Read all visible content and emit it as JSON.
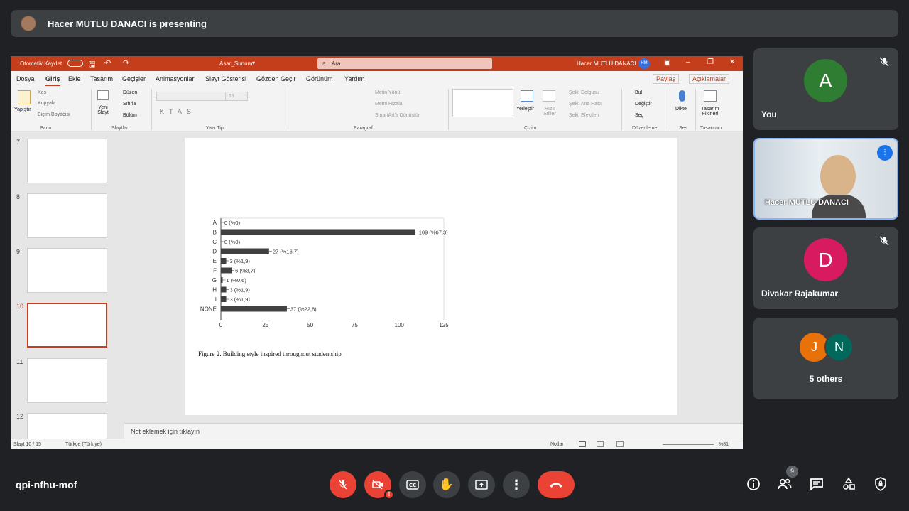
{
  "presenter_bar": {
    "text": "Hacer MUTLU DANACI is presenting"
  },
  "ppt": {
    "autosave": "Otomatik Kaydet",
    "filename": "Asar_Sunum",
    "search_placeholder": "Ara",
    "user_name": "Hacer MUTLU DANACI",
    "user_initials": "HM",
    "menus": [
      "Dosya",
      "Giriş",
      "Ekle",
      "Tasarım",
      "Geçişler",
      "Animasyonlar",
      "Slayt Gösterisi",
      "Gözden Geçir",
      "Görünüm",
      "Yardım"
    ],
    "share": "Paylaş",
    "comments": "Açıklamalar",
    "ribbon": {
      "paste": "Yapıştır",
      "cut": "Kes",
      "copy": "Kopyala",
      "format_painter": "Biçim Boyacısı",
      "new_slide": "Yeni Slayt",
      "layout": "Düzen",
      "reset": "Sıfırla",
      "section": "Bölüm",
      "font_size": "18",
      "text_direction": "Metin Yönü",
      "align_text": "Metni Hizala",
      "smartart": "SmartArt'a Dönüştür",
      "arrange": "Yerleştir",
      "quick_styles": "Hızlı Stiller",
      "shape_fill": "Şekil Dolgusu",
      "shape_outline": "Şekil Ana Hattı",
      "shape_effects": "Şekil Efektleri",
      "find": "Bul",
      "replace": "Değiştir",
      "select": "Seç",
      "dictate": "Dikte",
      "designer": "Tasarım Fikirleri",
      "groups": [
        "Pano",
        "Slaytlar",
        "Yazı Tipi",
        "Paragraf",
        "Çizim",
        "Düzenleme",
        "Ses",
        "Tasarımcı"
      ]
    },
    "slide_numbers": [
      "7",
      "8",
      "9",
      "10",
      "11",
      "12"
    ],
    "selected_slide": "10",
    "notes_placeholder": "Not eklemek için tıklayın",
    "status": {
      "slide": "Slayt 10 / 15",
      "language": "Türkçe (Türkiye)",
      "notes": "Notlar",
      "zoom": "%81"
    }
  },
  "chart_data": {
    "type": "bar",
    "orientation": "horizontal",
    "categories": [
      "A",
      "B",
      "C",
      "D",
      "E",
      "F",
      "G",
      "H",
      "I",
      "NONE"
    ],
    "values": [
      0,
      109,
      0,
      27,
      3,
      6,
      1,
      3,
      3,
      37
    ],
    "data_labels": [
      "0 (%0)",
      "109 (%67,3)",
      "0 (%0)",
      "27 (%16,7)",
      "3 (%1,9)",
      "6 (%3,7)",
      "1 (%0,6)",
      "3 (%1,9)",
      "3 (%1,9)",
      "37 (%22,8)"
    ],
    "xlim": [
      0,
      125
    ],
    "xticks": [
      "0",
      "25",
      "50",
      "75",
      "100",
      "125"
    ],
    "caption": "Figure 2. Building style inspired throughout studentship",
    "bar_color": "#404040"
  },
  "participants": [
    {
      "name": "You",
      "initial": "A",
      "color": "#2e7d32",
      "muted": true
    },
    {
      "name": "Hacer MUTLU DANACI",
      "speaking": true
    },
    {
      "name": "Divakar Rajakumar",
      "initial": "D",
      "color": "#d81b60",
      "muted": true
    },
    {
      "name": "5 others",
      "initials": [
        "J",
        "N"
      ],
      "colors": [
        "#e8710a",
        "#00695c"
      ]
    }
  ],
  "meeting": {
    "code": "qpi-nfhu-mof",
    "people_count": "9"
  }
}
